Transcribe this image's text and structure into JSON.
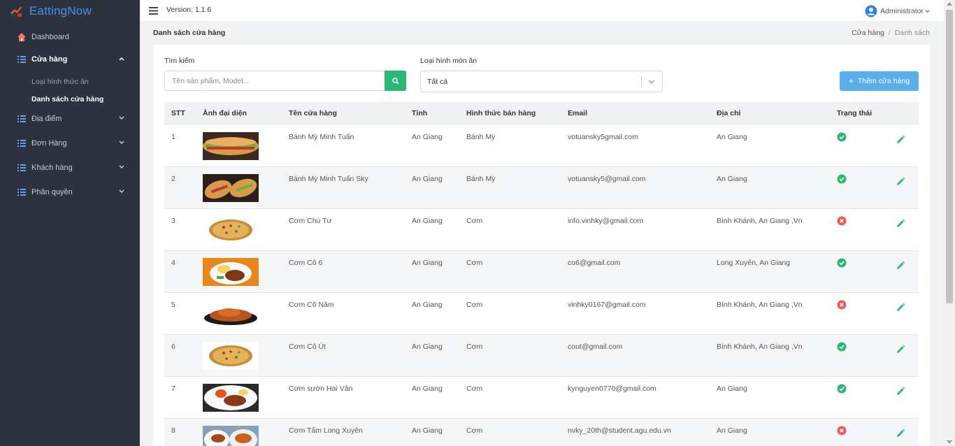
{
  "brand": {
    "name": "EattingNow"
  },
  "sidebar": {
    "items": [
      {
        "label": "Dashboard",
        "icon": "home-icon"
      },
      {
        "label": "Cửa hàng",
        "icon": "list-icon",
        "expanded": true
      },
      {
        "label": "Địa điểm",
        "icon": "list-icon"
      },
      {
        "label": "Đơn Hàng",
        "icon": "list-icon"
      },
      {
        "label": "Khách hàng",
        "icon": "list-icon"
      },
      {
        "label": "Phân quyền",
        "icon": "list-icon"
      }
    ],
    "sub_items": [
      {
        "label": "Loại hình thức ăn"
      },
      {
        "label": "Danh sách cửa hàng"
      }
    ]
  },
  "topbar": {
    "version": "Version: 1.1.6",
    "user": "Administrator"
  },
  "page": {
    "title": "Danh sách cửa hàng",
    "breadcrumb": [
      "Cửa hàng",
      "Danh sách"
    ]
  },
  "filters": {
    "search_label": "Tìm kiếm",
    "search_placeholder": "Tên sản phẩm, Model...",
    "type_label": "Loại hình món ăn",
    "type_value": "Tất cả",
    "add_button": "Thêm cửa hàng"
  },
  "table": {
    "headers": [
      "STT",
      "Ảnh đại diện",
      "Tên cửa hàng",
      "Tỉnh",
      "Hình thức bán hàng",
      "Email",
      "Địa chỉ",
      "Trạng thái"
    ],
    "rows": [
      {
        "stt": "1",
        "name": "Bánh Mỳ Minh Tuấn",
        "province": "An Giang",
        "type": "Bánh Mỳ",
        "email": "votuansky5gmail.com",
        "address": "An Giang",
        "active": true,
        "image": "banh-my"
      },
      {
        "stt": "2",
        "name": "Bánh Mỳ Minh Tuấn Sky",
        "province": "An Giang",
        "type": "Bánh Mỳ",
        "email": "votuansky5@gmail.com",
        "address": "An Giang",
        "active": true,
        "image": "banh-my-2"
      },
      {
        "stt": "3",
        "name": "Cơm Chú Tư",
        "province": "An Giang",
        "type": "Cơm",
        "email": "info.vinhky@gmail.com",
        "address": "Bình Khánh, An Giang ,Vn",
        "active": false,
        "image": "pizza"
      },
      {
        "stt": "4",
        "name": "Cơm Cô 6",
        "province": "An Giang",
        "type": "Cơm",
        "email": "co6@gmail.com",
        "address": "Long Xuyên, An Giang",
        "active": true,
        "image": "com-tam"
      },
      {
        "stt": "5",
        "name": "Cơm Cô Năm",
        "province": "An Giang",
        "type": "Cơm",
        "email": "vinhky0167@gmail.com",
        "address": "Bình Khánh, An Giang ,Vn",
        "active": false,
        "image": "ga-nuong"
      },
      {
        "stt": "6",
        "name": "Cơm Cô Út",
        "province": "An Giang",
        "type": "Cơm",
        "email": "cout@gmail.com",
        "address": "Bình Khánh, An Giang ,Vn",
        "active": true,
        "image": "pizza"
      },
      {
        "stt": "7",
        "name": "Cơm sườn Hai Vân",
        "province": "An Giang",
        "type": "Cơm",
        "email": "kynguyen0770@gmail.com",
        "address": "An Giang",
        "active": true,
        "image": "com-suon"
      },
      {
        "stt": "8",
        "name": "Cơm Tấm Long Xuyên",
        "province": "An Giang",
        "type": "Cơm",
        "email": "nvky_20th@student.agu.edu.vn",
        "address": "An Giang",
        "active": false,
        "image": "com-tam-2"
      }
    ]
  },
  "colors": {
    "sidebar": "#2c3240",
    "brand": "#4a90e2",
    "success": "#2bb673",
    "danger": "#ef5a5a",
    "primary_button": "#5aaeea"
  }
}
